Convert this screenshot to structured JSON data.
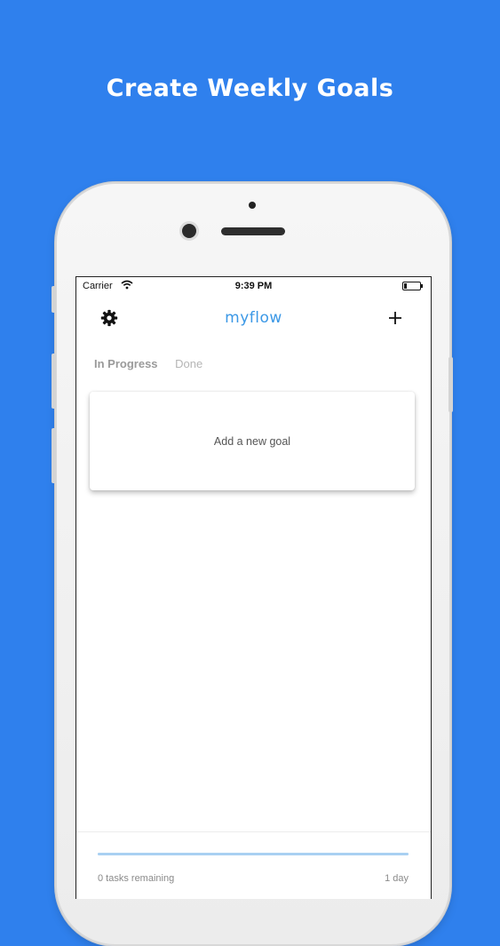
{
  "headline": "Create Weekly Goals",
  "status_bar": {
    "carrier": "Carrier",
    "time": "9:39 PM",
    "icons": [
      "wifi-icon",
      "battery-icon"
    ]
  },
  "nav": {
    "settings_icon": "gear-icon",
    "brand": "myflow",
    "add_icon": "plus-icon"
  },
  "tabs": [
    {
      "label": "In Progress",
      "active": true
    },
    {
      "label": "Done",
      "active": false
    }
  ],
  "goal_card": {
    "label": "Add a new goal"
  },
  "footer": {
    "progress": 1.0,
    "tasks_remaining": "0 tasks remaining",
    "days_left": "1 day"
  },
  "colors": {
    "background": "#2f80ed",
    "brand": "#3b98e6",
    "progress": "#a9d0f2"
  }
}
